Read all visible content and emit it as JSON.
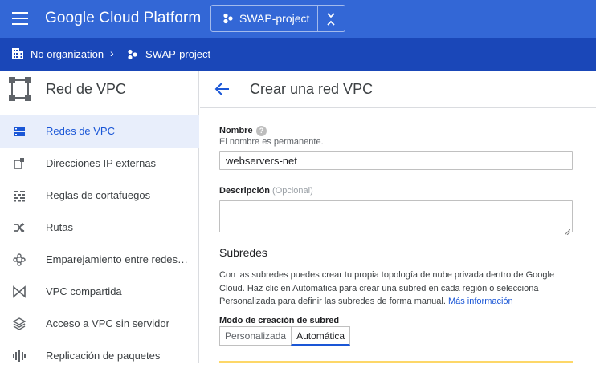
{
  "topbar": {
    "title": "Google Cloud Platform",
    "project_label": "SWAP-project",
    "bg_color": "#3367d6"
  },
  "breadcrumb": {
    "org_label": "No organization",
    "separator": "›",
    "project_label": "SWAP-project"
  },
  "sidebar": {
    "title": "Red de VPC",
    "items": [
      {
        "label": "Redes de VPC",
        "icon": "vpc-networks-icon",
        "active": true
      },
      {
        "label": "Direcciones IP externas",
        "icon": "external-ip-icon",
        "active": false
      },
      {
        "label": "Reglas de cortafuegos",
        "icon": "firewall-icon",
        "active": false
      },
      {
        "label": "Rutas",
        "icon": "routes-icon",
        "active": false
      },
      {
        "label": "Emparejamiento entre redes…",
        "icon": "peering-icon",
        "active": false
      },
      {
        "label": "VPC compartida",
        "icon": "shared-vpc-icon",
        "active": false
      },
      {
        "label": "Acceso a VPC sin servidor",
        "icon": "serverless-access-icon",
        "active": false
      },
      {
        "label": "Replicación de paquetes",
        "icon": "packet-mirroring-icon",
        "active": false
      }
    ]
  },
  "main": {
    "title": "Crear una red VPC",
    "name_label": "Nombre",
    "help_glyph": "?",
    "name_hint": "El nombre es permanente.",
    "name_value": "webservers-net",
    "desc_label": "Descripción",
    "desc_optional": "(Opcional)",
    "desc_value": "",
    "subnets_title": "Subredes",
    "subnets_text": "Con las subredes puedes crear tu propia topología de nube privada dentro de Google Cloud. Haz clic en Automática para crear una subred en cada región o selecciona Personalizada para definir las subredes de forma manual.",
    "more_info_link": "Más información",
    "mode_label": "Modo de creación de subred",
    "mode_options": [
      "Personalizada",
      "Automática"
    ],
    "mode_selected": "Automática"
  },
  "colors": {
    "accent": "#1a56d6",
    "active_bg": "#e8eefb",
    "breadcrumb_bg": "#1a47b8"
  }
}
